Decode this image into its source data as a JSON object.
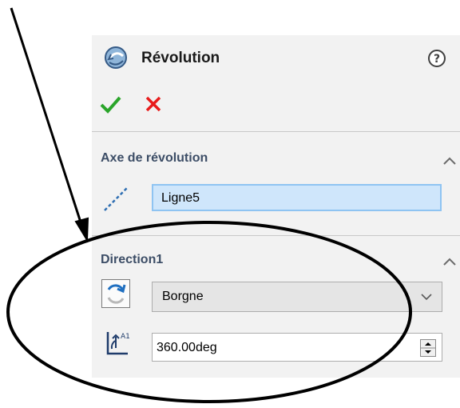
{
  "panel": {
    "title": "Révolution",
    "feature_icon": "revolve-feature-icon",
    "help_icon": "help-icon",
    "ok_icon": "checkmark-icon",
    "cancel_icon": "x-icon"
  },
  "axis_section": {
    "title": "Axe de révolution",
    "field_value": "Ligne5",
    "field_icon": "axis-line-icon"
  },
  "direction_section": {
    "title": "Direction1",
    "type_value": "Borgne",
    "type_icon": "reverse-direction-icon",
    "angle_value": "360.00deg",
    "angle_icon": "angle-icon"
  },
  "colors": {
    "ok": "#2aa52a",
    "cancel": "#e81b1b",
    "section_title": "#3c4d66",
    "selection_field": "#cfe6fb",
    "selection_border": "#8fc4f2",
    "panel_bg": "#f2f2f2"
  }
}
